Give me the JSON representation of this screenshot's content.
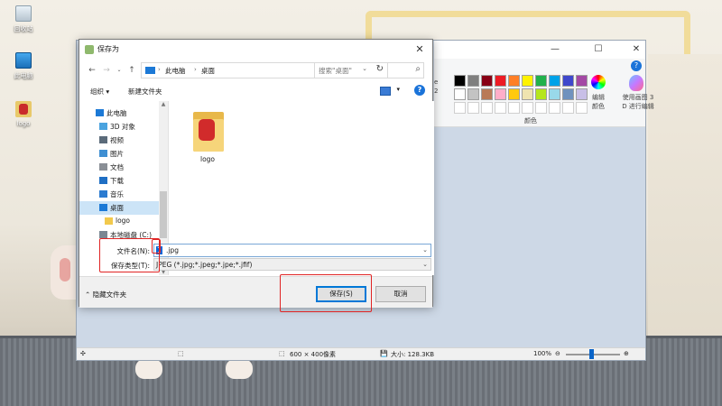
{
  "desktop": {
    "icons": [
      {
        "label": "回收站",
        "icon": "recycle-bin-icon"
      },
      {
        "label": "此电脑",
        "icon": "this-pc-icon"
      },
      {
        "label": "logo",
        "icon": "logo-file-icon"
      }
    ]
  },
  "paint": {
    "ribbon": {
      "colors_group_label": "颜色",
      "edit_colors_label": "编辑\n颜色",
      "paint3d_label": "使用画图 3\nD 进行编辑",
      "partial_label_1": "e",
      "partial_label_2": "2",
      "palette": [
        "#000000",
        "#7f7f7f",
        "#880015",
        "#ed1c24",
        "#ff7f27",
        "#fff200",
        "#22b14c",
        "#00a2e8",
        "#3f48cc",
        "#a349a4",
        "#ffffff",
        "#c3c3c3",
        "#b97a57",
        "#ffaec9",
        "#ffc90e",
        "#efe4b0",
        "#b5e61d",
        "#99d9ea",
        "#7092be",
        "#c8bfe7"
      ]
    },
    "status": {
      "dimensions": "600 × 400像素",
      "size": "大小: 128.3KB",
      "zoom": "100%"
    }
  },
  "dialog": {
    "title": "保存为",
    "nav": {
      "crumbs": [
        "此电脑",
        "桌面"
      ],
      "search_placeholder": "搜索\"桌面\""
    },
    "commands": {
      "organize": "组织 ▾",
      "new_folder": "新建文件夹"
    },
    "tree": [
      {
        "label": "此电脑",
        "icon": "computer-icon"
      },
      {
        "label": "3D 对象",
        "icon": "3d-objects-icon"
      },
      {
        "label": "视频",
        "icon": "videos-icon"
      },
      {
        "label": "图片",
        "icon": "pictures-icon"
      },
      {
        "label": "文档",
        "icon": "documents-icon"
      },
      {
        "label": "下载",
        "icon": "downloads-icon"
      },
      {
        "label": "音乐",
        "icon": "music-icon"
      },
      {
        "label": "桌面",
        "icon": "desktop-icon",
        "selected": true
      },
      {
        "label": "logo",
        "icon": "folder-icon"
      },
      {
        "label": "本地磁盘 (C:)",
        "icon": "drive-icon"
      }
    ],
    "files": [
      {
        "name": "logo",
        "type": "folder"
      }
    ],
    "filename_label": "文件名(N):",
    "filename_selected": "1",
    "filename_rest": ".jpg",
    "savetype_label": "保存类型(T):",
    "savetype_value": "JPEG (*.jpg;*.jpeg;*.jpe;*.jfif)",
    "hide_folders": "隐藏文件夹",
    "save_button": "保存(S)",
    "cancel_button": "取消"
  },
  "highlight_color": "#e02424"
}
